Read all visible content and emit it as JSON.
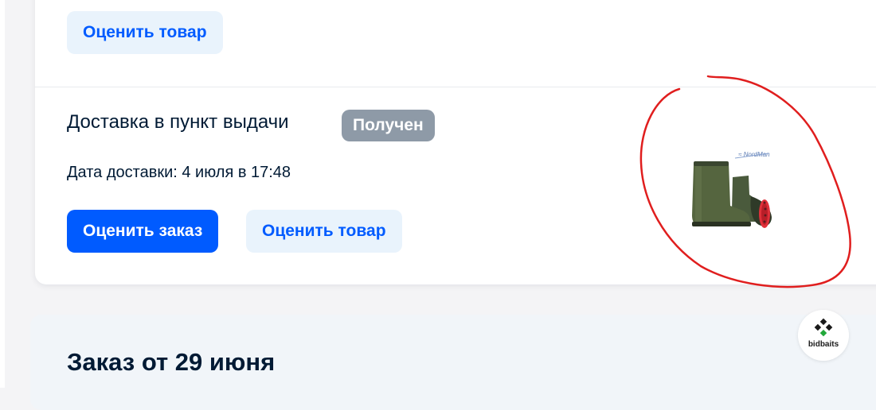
{
  "top_section": {
    "rate_item_label": "Оценить товар"
  },
  "delivery": {
    "title": "Доставка в пункт выдачи",
    "status": "Получен",
    "date_text": "Дата доставки: 4 июля в 17:48",
    "rate_order_label": "Оценить заказ",
    "rate_item_label": "Оценить товар"
  },
  "next_order": {
    "title": "Заказ от 29 июня"
  },
  "watermark": {
    "text": "bidbaits"
  },
  "colors": {
    "accent": "#005bff",
    "accent_light_bg": "#e9f3fc",
    "status_badge": "#8e9aa7",
    "annotation": "#e01e1e",
    "text": "#001a34"
  }
}
